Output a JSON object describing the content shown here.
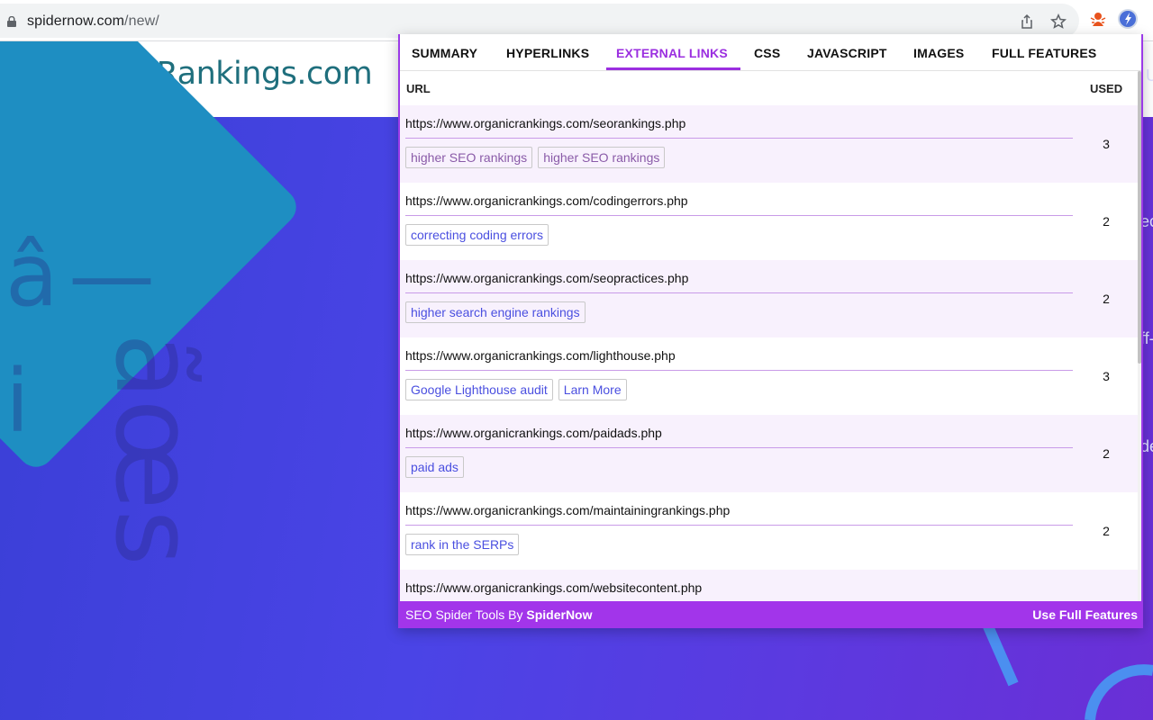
{
  "browser": {
    "url_host": "spidernow.com",
    "url_path": "/new/",
    "icons": [
      "lock-icon",
      "share-icon",
      "star-icon",
      "extension-spider-icon",
      "extension-spidernow-icon"
    ]
  },
  "site": {
    "logo_text": "rganicRankings.com",
    "brand_color": "#1f6f7d",
    "hero_colors": [
      "#3a3fd6",
      "#6a2fd6"
    ],
    "accent_shape_color": "#1e8ec2",
    "hero_glyphs": [
      "â",
      "—",
      "i",
      "ãœs"
    ],
    "side_fragments": [
      "U",
      "ec",
      "ff-",
      "de"
    ]
  },
  "popup": {
    "accent_color": "#9b2fe0",
    "tabs": [
      {
        "label": "SUMMARY",
        "active": false
      },
      {
        "label": "HYPERLINKS",
        "active": false
      },
      {
        "label": "EXTERNAL LINKS",
        "active": true
      },
      {
        "label": "CSS",
        "active": false
      },
      {
        "label": "JAVASCRIPT",
        "active": false
      },
      {
        "label": "IMAGES",
        "active": false
      },
      {
        "label": "FULL FEATURES",
        "active": false
      }
    ],
    "columns": {
      "url": "URL",
      "used": "USED"
    },
    "rows": [
      {
        "url": "https://www.organicrankings.com/seorankings.php",
        "anchors": [
          "higher SEO rankings",
          "higher SEO rankings"
        ],
        "used": "3"
      },
      {
        "url": "https://www.organicrankings.com/codingerrors.php",
        "anchors": [
          "correcting coding errors"
        ],
        "used": "2"
      },
      {
        "url": "https://www.organicrankings.com/seopractices.php",
        "anchors": [
          "higher search engine rankings"
        ],
        "used": "2"
      },
      {
        "url": "https://www.organicrankings.com/lighthouse.php",
        "anchors": [
          "Google Lighthouse audit",
          "Larn More"
        ],
        "used": "3"
      },
      {
        "url": "https://www.organicrankings.com/paidads.php",
        "anchors": [
          "paid ads"
        ],
        "used": "2"
      },
      {
        "url": "https://www.organicrankings.com/maintainingrankings.php",
        "anchors": [
          "rank in the SERPs"
        ],
        "used": "2"
      },
      {
        "url": "https://www.organicrankings.com/websitecontent.php",
        "anchors": [],
        "used": ""
      }
    ],
    "footer": {
      "prefix": "SEO Spider Tools By ",
      "brand": "SpiderNow",
      "action": "Use Full Features"
    }
  }
}
